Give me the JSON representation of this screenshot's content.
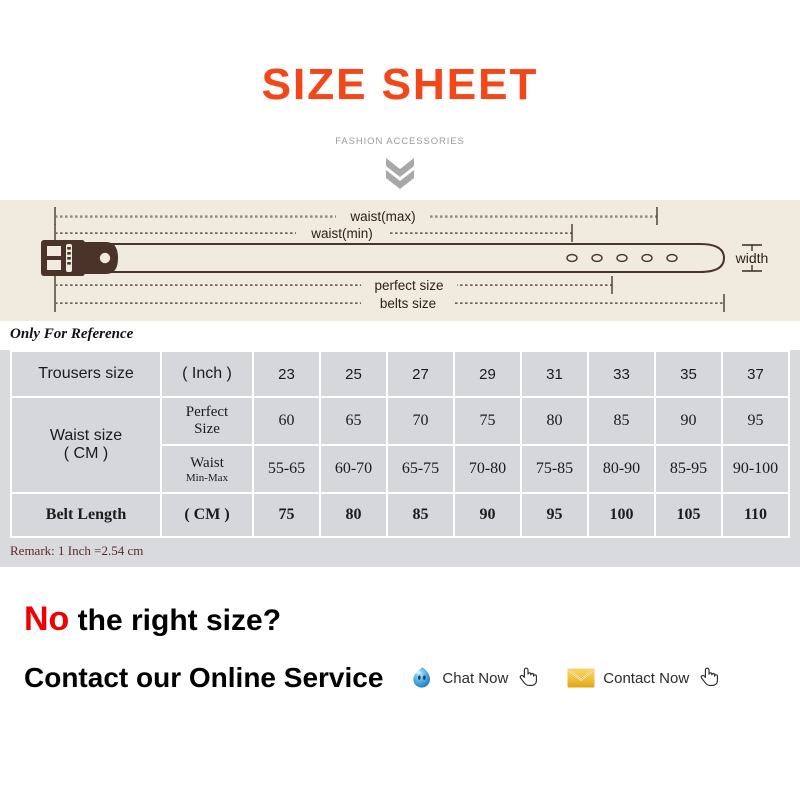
{
  "header": {
    "title": "SIZE SHEET",
    "subtitle": "FASHION ACCESSORIES",
    "chevron_icon": "double-chevron-down-icon",
    "title_color": "#f1481b",
    "subtitle_color": "#9b9b9b"
  },
  "diagram": {
    "background_color": "#f1ebdf",
    "belt_color": "#4a3328",
    "labels": {
      "waist_max": "waist(max)",
      "waist_min": "waist(min)",
      "perfect_size": "perfect size",
      "belts_size": "belts size",
      "width": "width"
    },
    "hole_count": 5
  },
  "reference_note": "Only For Reference",
  "table": {
    "row_labels": {
      "trousers_size": "Trousers size",
      "trousers_unit": "( Inch )",
      "waist_size": "Waist size",
      "waist_unit": "( CM )",
      "perfect_size": "Perfect",
      "perfect_size_2": "Size",
      "waist_minmax": "Waist",
      "waist_minmax_2": "Min-Max",
      "belt_length": "Belt Length",
      "belt_unit": "( CM )"
    },
    "columns": [
      {
        "trousers_inch": "23",
        "perfect_size": "60",
        "waist_min_max": "55-65",
        "belt_length": "75"
      },
      {
        "trousers_inch": "25",
        "perfect_size": "65",
        "waist_min_max": "60-70",
        "belt_length": "80"
      },
      {
        "trousers_inch": "27",
        "perfect_size": "70",
        "waist_min_max": "65-75",
        "belt_length": "85"
      },
      {
        "trousers_inch": "29",
        "perfect_size": "75",
        "waist_min_max": "70-80",
        "belt_length": "90"
      },
      {
        "trousers_inch": "31",
        "perfect_size": "80",
        "waist_min_max": "75-85",
        "belt_length": "95"
      },
      {
        "trousers_inch": "33",
        "perfect_size": "85",
        "waist_min_max": "80-90",
        "belt_length": "100"
      },
      {
        "trousers_inch": "35",
        "perfect_size": "90",
        "waist_min_max": "85-95",
        "belt_length": "105"
      },
      {
        "trousers_inch": "37",
        "perfect_size": "95",
        "waist_min_max": "90-100",
        "belt_length": "110"
      }
    ],
    "cell_color": "#d6d7dc",
    "zone_color": "#d9dade"
  },
  "remark": "Remark: 1 Inch =2.54 cm",
  "footer": {
    "no_word": "No",
    "question": "the right size?",
    "contact_line": "Contact our Online Service",
    "no_color": "#f00000",
    "actions": [
      {
        "label": "Chat Now",
        "icon": "chat-droplet-icon",
        "cursor_icon": "pointing-hand-icon",
        "icon_color": "#3c9fe0"
      },
      {
        "label": "Contact Now",
        "icon": "envelope-icon",
        "cursor_icon": "pointing-hand-icon",
        "icon_color": "#f0c03c"
      }
    ]
  }
}
